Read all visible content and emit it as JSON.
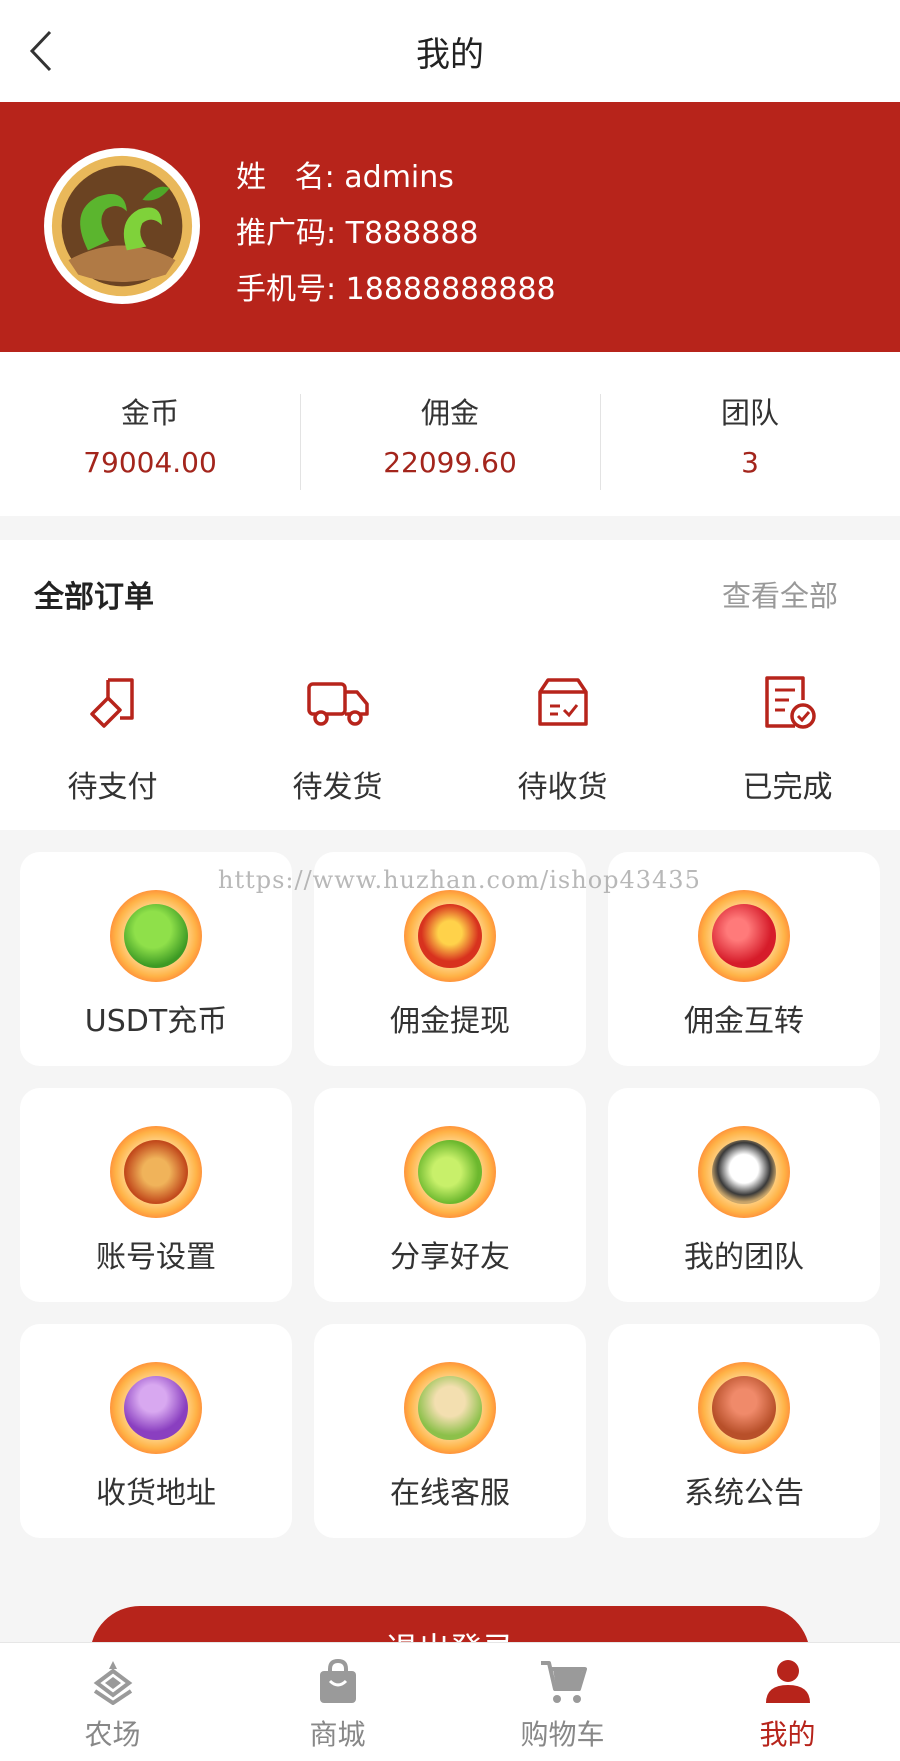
{
  "header": {
    "title": "我的"
  },
  "profile": {
    "name_label": "姓   名: ",
    "name": "admins",
    "code_label": "推广码: ",
    "code": "T888888",
    "phone_label": "手机号: ",
    "phone": "18888888888"
  },
  "stats": [
    {
      "label": "金币",
      "value": "79004.00"
    },
    {
      "label": "佣金",
      "value": "22099.60"
    },
    {
      "label": "团队",
      "value": "3"
    }
  ],
  "orders": {
    "title": "全部订单",
    "view_all": "查看全部",
    "items": [
      {
        "label": "待支付",
        "icon": "pending-payment-icon"
      },
      {
        "label": "待发货",
        "icon": "truck-icon"
      },
      {
        "label": "待收货",
        "icon": "box-icon"
      },
      {
        "label": "已完成",
        "icon": "completed-doc-icon"
      }
    ]
  },
  "watermark": "https://www.huzhan.com/ishop43435",
  "menu": [
    {
      "label": "USDT充币",
      "icon": "usdt-recharge-icon"
    },
    {
      "label": "佣金提现",
      "icon": "withdraw-icon"
    },
    {
      "label": "佣金互转",
      "icon": "transfer-icon"
    },
    {
      "label": "账号设置",
      "icon": "account-settings-icon"
    },
    {
      "label": "分享好友",
      "icon": "share-friends-icon"
    },
    {
      "label": "我的团队",
      "icon": "my-team-icon"
    },
    {
      "label": "收货地址",
      "icon": "address-icon"
    },
    {
      "label": "在线客服",
      "icon": "customer-service-icon"
    },
    {
      "label": "系统公告",
      "icon": "announcement-icon"
    }
  ],
  "logout_label": "退出登录",
  "tabbar": [
    {
      "label": "农场",
      "icon": "farm-icon",
      "active": false
    },
    {
      "label": "商城",
      "icon": "shop-bag-icon",
      "active": false
    },
    {
      "label": "购物车",
      "icon": "cart-icon",
      "active": false
    },
    {
      "label": "我的",
      "icon": "user-icon",
      "active": true
    }
  ],
  "colors": {
    "brand": "#b7241b",
    "value_text": "#a3251c",
    "inactive_tab": "#888888"
  }
}
